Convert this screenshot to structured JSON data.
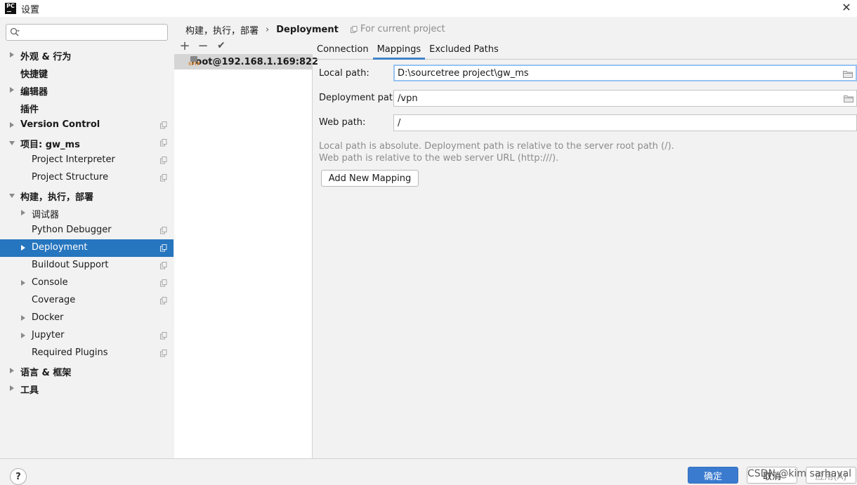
{
  "window": {
    "title": "设置",
    "logo": "PC"
  },
  "search": {
    "placeholder": ""
  },
  "sidebar": {
    "items": [
      {
        "label": "外观 & 行为",
        "bold": true,
        "arrow": "right",
        "level": 0
      },
      {
        "label": "快捷键",
        "bold": true,
        "arrow": "",
        "level": 0
      },
      {
        "label": "编辑器",
        "bold": true,
        "arrow": "right",
        "level": 0
      },
      {
        "label": "插件",
        "bold": true,
        "arrow": "",
        "level": 0
      },
      {
        "label": "Version Control",
        "bold": true,
        "arrow": "right",
        "level": 0,
        "copy": true
      },
      {
        "label": "项目: gw_ms",
        "bold": true,
        "arrow": "down",
        "level": 0,
        "copy": true
      },
      {
        "label": "Project Interpreter",
        "bold": false,
        "arrow": "",
        "level": 1,
        "copy": true
      },
      {
        "label": "Project Structure",
        "bold": false,
        "arrow": "",
        "level": 1,
        "copy": true
      },
      {
        "label": "构建，执行，部署",
        "bold": true,
        "arrow": "down",
        "level": 0
      },
      {
        "label": "调试器",
        "bold": false,
        "arrow": "right",
        "level": 1
      },
      {
        "label": "Python Debugger",
        "bold": false,
        "arrow": "",
        "level": 1,
        "copy": true
      },
      {
        "label": "Deployment",
        "bold": false,
        "arrow": "right",
        "level": 1,
        "copy": true,
        "selected": true
      },
      {
        "label": "Buildout Support",
        "bold": false,
        "arrow": "",
        "level": 1,
        "copy": true
      },
      {
        "label": "Console",
        "bold": false,
        "arrow": "right",
        "level": 1,
        "copy": true
      },
      {
        "label": "Coverage",
        "bold": false,
        "arrow": "",
        "level": 1,
        "copy": true
      },
      {
        "label": "Docker",
        "bold": false,
        "arrow": "right",
        "level": 1
      },
      {
        "label": "Jupyter",
        "bold": false,
        "arrow": "right",
        "level": 1,
        "copy": true
      },
      {
        "label": "Required Plugins",
        "bold": false,
        "arrow": "",
        "level": 1,
        "copy": true
      },
      {
        "label": "语言 & 框架",
        "bold": true,
        "arrow": "right",
        "level": 0
      },
      {
        "label": "工具",
        "bold": true,
        "arrow": "right",
        "level": 0
      }
    ]
  },
  "breadcrumb": {
    "parent": "构建，执行，部署",
    "separator": "›",
    "current": "Deployment"
  },
  "scope": {
    "label": "For current project"
  },
  "toolbar": {
    "add": "+",
    "remove": "−",
    "check": "✔"
  },
  "servers": [
    {
      "label": "root@192.168.1.169:822",
      "icon_text": "SFTP"
    }
  ],
  "tabs": [
    {
      "label": "Connection",
      "active": false
    },
    {
      "label": "Mappings",
      "active": true
    },
    {
      "label": "Excluded Paths",
      "active": false
    }
  ],
  "mapping": {
    "local_path_label": "Local path:",
    "local_path_value": "D:\\sourcetree project\\gw_ms",
    "deployment_path_label": "Deployment path:",
    "deployment_path_value": "/vpn",
    "web_path_label": "Web path:",
    "web_path_value": "/",
    "hint_line1": "Local path is absolute. Deployment path is relative to the server root path (/).",
    "hint_line2": "Web path is relative to the web server URL (http:///).",
    "add_mapping_button": "Add New Mapping"
  },
  "footer": {
    "help": "?",
    "ok": "确定",
    "cancel": "取消",
    "apply": "应用(A)",
    "watermark": "CSDN @kim sarhaval"
  },
  "colors": {
    "selection": "#2675bf",
    "primary_button": "#3b7bcf",
    "tab_underline": "#4083c9"
  }
}
